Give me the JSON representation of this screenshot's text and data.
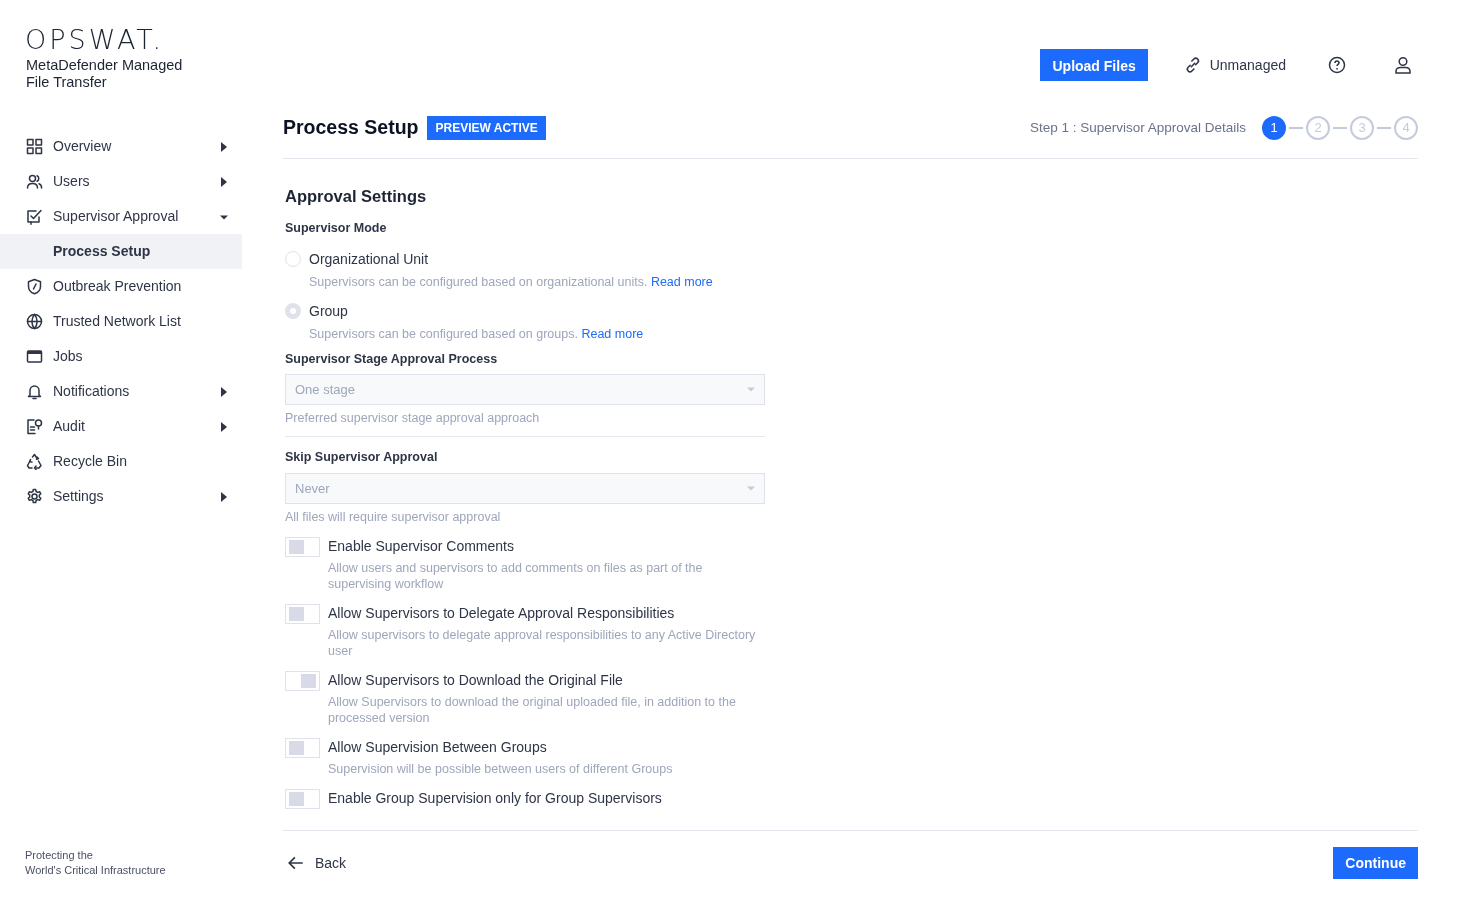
{
  "brand": {
    "logo": "OPSWAT.",
    "product": [
      "MetaDefender Managed",
      "File Transfer"
    ],
    "tagline": [
      "Protecting the",
      "World's Critical Infrastructure"
    ]
  },
  "sidebar": {
    "items": [
      {
        "kind": "grid",
        "label": "Overview",
        "expanded": false,
        "selected": false
      },
      {
        "kind": "users",
        "label": "Users",
        "expanded": false,
        "selected": false
      },
      {
        "kind": "approval",
        "label": "Supervisor Approval",
        "expanded": true,
        "selected": false,
        "children": [
          {
            "label": "Process Setup",
            "selected": true
          }
        ]
      },
      {
        "kind": "shield",
        "label": "Outbreak Prevention",
        "selected": false
      },
      {
        "kind": "globe",
        "label": "Trusted Network List",
        "selected": false
      },
      {
        "kind": "window",
        "label": "Jobs",
        "selected": false
      },
      {
        "kind": "bell",
        "label": "Notifications",
        "expanded": false,
        "selected": false
      },
      {
        "kind": "audit",
        "label": "Audit",
        "expanded": false,
        "selected": false
      },
      {
        "kind": "recycle",
        "label": "Recycle Bin",
        "selected": false
      },
      {
        "kind": "gear",
        "label": "Settings",
        "expanded": false,
        "selected": false
      }
    ]
  },
  "header": {
    "upload_button": "Upload Files",
    "status": "Unmanaged"
  },
  "page": {
    "title": "Process Setup",
    "badge": "PREVIEW ACTIVE",
    "step_text": "Step 1 : Supervisor Approval Details",
    "steps": [
      {
        "label": "1",
        "selected": true
      },
      {
        "label": "2",
        "selected": false
      },
      {
        "label": "3",
        "selected": false
      },
      {
        "label": "4",
        "selected": false
      }
    ]
  },
  "form": {
    "section_title": "Approval Settings",
    "mode_label": "Supervisor Mode",
    "radios": [
      {
        "label": "Organizational Unit",
        "hint": "Supervisors can be configured based on organizational units.",
        "link": "Read more",
        "selected": false
      },
      {
        "label": "Group",
        "hint": "Supervisors can be configured based on groups.",
        "link": "Read more",
        "selected": true
      }
    ],
    "selects": [
      {
        "label": "Supervisor Stage Approval Process",
        "value": "One stage",
        "hint": "Preferred supervisor stage approval approach"
      },
      {
        "label": "Skip Supervisor Approval",
        "value": "Never",
        "hint": "All files will require supervisor approval"
      }
    ],
    "toggles": [
      {
        "label": "Enable Supervisor Comments",
        "hint": "Allow users and supervisors to add comments on files as part of the supervising workflow",
        "on": false
      },
      {
        "label": "Allow Supervisors to Delegate Approval Responsibilities",
        "hint": "Allow supervisors to delegate approval responsibilities to any Active Directory user",
        "on": false
      },
      {
        "label": "Allow Supervisors to Download the Original File",
        "hint": "Allow Supervisors to download the original uploaded file, in addition to the processed version",
        "on": true
      },
      {
        "label": "Allow Supervision Between Groups",
        "hint": "Supervision will be possible between users of different Groups",
        "on": false
      },
      {
        "label": "Enable Group Supervision only for Group Supervisors",
        "on": false
      }
    ]
  },
  "footer": {
    "back": "Back",
    "continue": "Continue"
  }
}
